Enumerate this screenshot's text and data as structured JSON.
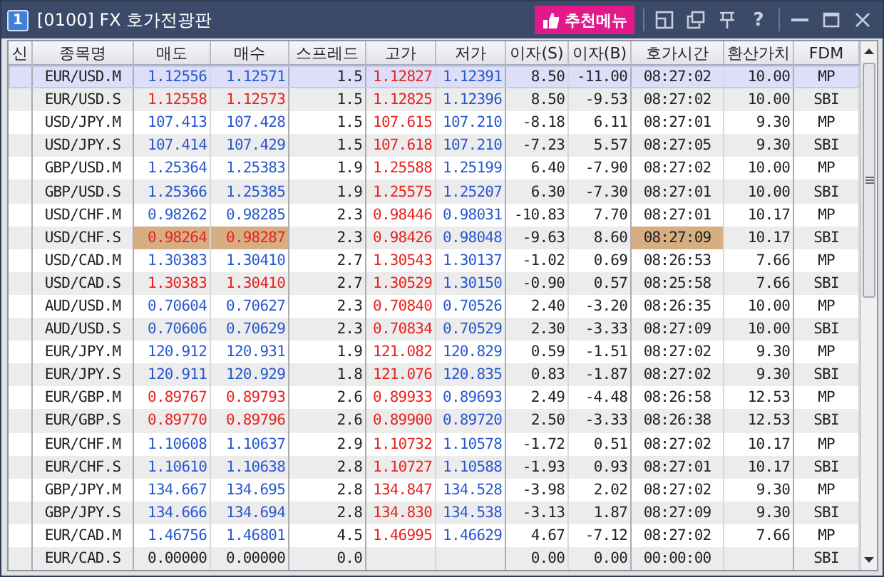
{
  "window": {
    "badge": "1",
    "title": "[0100] FX 호가전광판",
    "recommend_button": "추천메뉴",
    "help_button": "?"
  },
  "table": {
    "columns": [
      "신",
      "종목명",
      "매도",
      "매수",
      "스프레드",
      "고가",
      "저가",
      "이자(S)",
      "이자(B)",
      "호가시간",
      "환산가치",
      "FDM"
    ],
    "rows": [
      {
        "symbol": "EUR/USD.M",
        "sell": {
          "value": "1.12556",
          "color": "#2858d0"
        },
        "buy": {
          "value": "1.12571",
          "color": "#2858d0"
        },
        "spread": "1.5",
        "high": "1.12827",
        "low": "1.12391",
        "swap_s": "8.50",
        "swap_b": "-11.00",
        "time": "08:27:02",
        "rate": "10.00",
        "fdm": "MP",
        "flashed": false,
        "selected": true
      },
      {
        "symbol": "EUR/USD.S",
        "sell": {
          "value": "1.12558",
          "color": "#e8231e"
        },
        "buy": {
          "value": "1.12573",
          "color": "#e8231e"
        },
        "spread": "1.5",
        "high": "1.12825",
        "low": "1.12396",
        "swap_s": "8.50",
        "swap_b": "-9.53",
        "time": "08:27:02",
        "rate": "10.00",
        "fdm": "SBI",
        "flashed": false,
        "selected": false
      },
      {
        "symbol": "USD/JPY.M",
        "sell": {
          "value": "107.413",
          "color": "#2858d0"
        },
        "buy": {
          "value": "107.428",
          "color": "#2858d0"
        },
        "spread": "1.5",
        "high": "107.615",
        "low": "107.210",
        "swap_s": "-8.18",
        "swap_b": "6.11",
        "time": "08:27:01",
        "rate": "9.30",
        "fdm": "MP",
        "flashed": false,
        "selected": false
      },
      {
        "symbol": "USD/JPY.S",
        "sell": {
          "value": "107.414",
          "color": "#2858d0"
        },
        "buy": {
          "value": "107.429",
          "color": "#2858d0"
        },
        "spread": "1.5",
        "high": "107.618",
        "low": "107.210",
        "swap_s": "-7.23",
        "swap_b": "5.57",
        "time": "08:27:05",
        "rate": "9.30",
        "fdm": "SBI",
        "flashed": false,
        "selected": false
      },
      {
        "symbol": "GBP/USD.M",
        "sell": {
          "value": "1.25364",
          "color": "#2858d0"
        },
        "buy": {
          "value": "1.25383",
          "color": "#2858d0"
        },
        "spread": "1.9",
        "high": "1.25588",
        "low": "1.25199",
        "swap_s": "6.40",
        "swap_b": "-7.90",
        "time": "08:27:02",
        "rate": "10.00",
        "fdm": "MP",
        "flashed": false,
        "selected": false
      },
      {
        "symbol": "GBP/USD.S",
        "sell": {
          "value": "1.25366",
          "color": "#2858d0"
        },
        "buy": {
          "value": "1.25385",
          "color": "#2858d0"
        },
        "spread": "1.9",
        "high": "1.25575",
        "low": "1.25207",
        "swap_s": "6.30",
        "swap_b": "-7.30",
        "time": "08:27:01",
        "rate": "10.00",
        "fdm": "SBI",
        "flashed": false,
        "selected": false
      },
      {
        "symbol": "USD/CHF.M",
        "sell": {
          "value": "0.98262",
          "color": "#2858d0"
        },
        "buy": {
          "value": "0.98285",
          "color": "#2858d0"
        },
        "spread": "2.3",
        "high": "0.98446",
        "low": "0.98031",
        "swap_s": "-10.83",
        "swap_b": "7.70",
        "time": "08:27:01",
        "rate": "10.17",
        "fdm": "MP",
        "flashed": false,
        "selected": false
      },
      {
        "symbol": "USD/CHF.S",
        "sell": {
          "value": "0.98264",
          "color": "#e8231e"
        },
        "buy": {
          "value": "0.98287",
          "color": "#e8231e"
        },
        "spread": "2.3",
        "high": "0.98426",
        "low": "0.98048",
        "swap_s": "-9.63",
        "swap_b": "8.60",
        "time": "08:27:09",
        "rate": "10.17",
        "fdm": "SBI",
        "flashed": true,
        "selected": false
      },
      {
        "symbol": "USD/CAD.M",
        "sell": {
          "value": "1.30383",
          "color": "#2858d0"
        },
        "buy": {
          "value": "1.30410",
          "color": "#2858d0"
        },
        "spread": "2.7",
        "high": "1.30543",
        "low": "1.30137",
        "swap_s": "-1.02",
        "swap_b": "0.69",
        "time": "08:26:53",
        "rate": "7.66",
        "fdm": "MP",
        "flashed": false,
        "selected": false
      },
      {
        "symbol": "USD/CAD.S",
        "sell": {
          "value": "1.30383",
          "color": "#e8231e"
        },
        "buy": {
          "value": "1.30410",
          "color": "#e8231e"
        },
        "spread": "2.7",
        "high": "1.30529",
        "low": "1.30150",
        "swap_s": "-0.90",
        "swap_b": "0.57",
        "time": "08:25:58",
        "rate": "7.66",
        "fdm": "SBI",
        "flashed": false,
        "selected": false
      },
      {
        "symbol": "AUD/USD.M",
        "sell": {
          "value": "0.70604",
          "color": "#2858d0"
        },
        "buy": {
          "value": "0.70627",
          "color": "#2858d0"
        },
        "spread": "2.3",
        "high": "0.70840",
        "low": "0.70526",
        "swap_s": "2.40",
        "swap_b": "-3.20",
        "time": "08:26:35",
        "rate": "10.00",
        "fdm": "MP",
        "flashed": false,
        "selected": false
      },
      {
        "symbol": "AUD/USD.S",
        "sell": {
          "value": "0.70606",
          "color": "#2858d0"
        },
        "buy": {
          "value": "0.70629",
          "color": "#2858d0"
        },
        "spread": "2.3",
        "high": "0.70834",
        "low": "0.70529",
        "swap_s": "2.30",
        "swap_b": "-3.33",
        "time": "08:27:09",
        "rate": "10.00",
        "fdm": "SBI",
        "flashed": false,
        "selected": false
      },
      {
        "symbol": "EUR/JPY.M",
        "sell": {
          "value": "120.912",
          "color": "#2858d0"
        },
        "buy": {
          "value": "120.931",
          "color": "#2858d0"
        },
        "spread": "1.9",
        "high": "121.082",
        "low": "120.829",
        "swap_s": "0.59",
        "swap_b": "-1.51",
        "time": "08:27:02",
        "rate": "9.30",
        "fdm": "MP",
        "flashed": false,
        "selected": false
      },
      {
        "symbol": "EUR/JPY.S",
        "sell": {
          "value": "120.911",
          "color": "#2858d0"
        },
        "buy": {
          "value": "120.929",
          "color": "#2858d0"
        },
        "spread": "1.8",
        "high": "121.076",
        "low": "120.835",
        "swap_s": "0.83",
        "swap_b": "-1.87",
        "time": "08:27:02",
        "rate": "9.30",
        "fdm": "SBI",
        "flashed": false,
        "selected": false
      },
      {
        "symbol": "EUR/GBP.M",
        "sell": {
          "value": "0.89767",
          "color": "#e8231e"
        },
        "buy": {
          "value": "0.89793",
          "color": "#e8231e"
        },
        "spread": "2.6",
        "high": "0.89933",
        "low": "0.89693",
        "swap_s": "2.49",
        "swap_b": "-4.48",
        "time": "08:26:58",
        "rate": "12.53",
        "fdm": "MP",
        "flashed": false,
        "selected": false
      },
      {
        "symbol": "EUR/GBP.S",
        "sell": {
          "value": "0.89770",
          "color": "#e8231e"
        },
        "buy": {
          "value": "0.89796",
          "color": "#e8231e"
        },
        "spread": "2.6",
        "high": "0.89900",
        "low": "0.89720",
        "swap_s": "2.50",
        "swap_b": "-3.33",
        "time": "08:26:38",
        "rate": "12.53",
        "fdm": "SBI",
        "flashed": false,
        "selected": false
      },
      {
        "symbol": "EUR/CHF.M",
        "sell": {
          "value": "1.10608",
          "color": "#2858d0"
        },
        "buy": {
          "value": "1.10637",
          "color": "#2858d0"
        },
        "spread": "2.9",
        "high": "1.10732",
        "low": "1.10578",
        "swap_s": "-1.72",
        "swap_b": "0.51",
        "time": "08:27:02",
        "rate": "10.17",
        "fdm": "MP",
        "flashed": false,
        "selected": false
      },
      {
        "symbol": "EUR/CHF.S",
        "sell": {
          "value": "1.10610",
          "color": "#2858d0"
        },
        "buy": {
          "value": "1.10638",
          "color": "#2858d0"
        },
        "spread": "2.8",
        "high": "1.10727",
        "low": "1.10588",
        "swap_s": "-1.93",
        "swap_b": "0.93",
        "time": "08:27:01",
        "rate": "10.17",
        "fdm": "SBI",
        "flashed": false,
        "selected": false
      },
      {
        "symbol": "GBP/JPY.M",
        "sell": {
          "value": "134.667",
          "color": "#2858d0"
        },
        "buy": {
          "value": "134.695",
          "color": "#2858d0"
        },
        "spread": "2.8",
        "high": "134.847",
        "low": "134.528",
        "swap_s": "-3.98",
        "swap_b": "2.02",
        "time": "08:27:02",
        "rate": "9.30",
        "fdm": "MP",
        "flashed": false,
        "selected": false
      },
      {
        "symbol": "GBP/JPY.S",
        "sell": {
          "value": "134.666",
          "color": "#2858d0"
        },
        "buy": {
          "value": "134.694",
          "color": "#2858d0"
        },
        "spread": "2.8",
        "high": "134.830",
        "low": "134.538",
        "swap_s": "-3.13",
        "swap_b": "1.87",
        "time": "08:27:09",
        "rate": "9.30",
        "fdm": "SBI",
        "flashed": false,
        "selected": false
      },
      {
        "symbol": "EUR/CAD.M",
        "sell": {
          "value": "1.46756",
          "color": "#2858d0"
        },
        "buy": {
          "value": "1.46801",
          "color": "#2858d0"
        },
        "spread": "4.5",
        "high": "1.46995",
        "low": "1.46629",
        "swap_s": "4.67",
        "swap_b": "-7.12",
        "time": "08:27:02",
        "rate": "7.66",
        "fdm": "MP",
        "flashed": false,
        "selected": false
      },
      {
        "symbol": "EUR/CAD.S",
        "sell": {
          "value": "0.00000",
          "color": "#222222"
        },
        "buy": {
          "value": "0.00000",
          "color": "#222222"
        },
        "spread": "0.0",
        "swap_s": "0.00",
        "swap_b": "0.00",
        "time": "00:00:00",
        "fdm": "SBI",
        "flashed": false,
        "selected": false
      }
    ]
  }
}
